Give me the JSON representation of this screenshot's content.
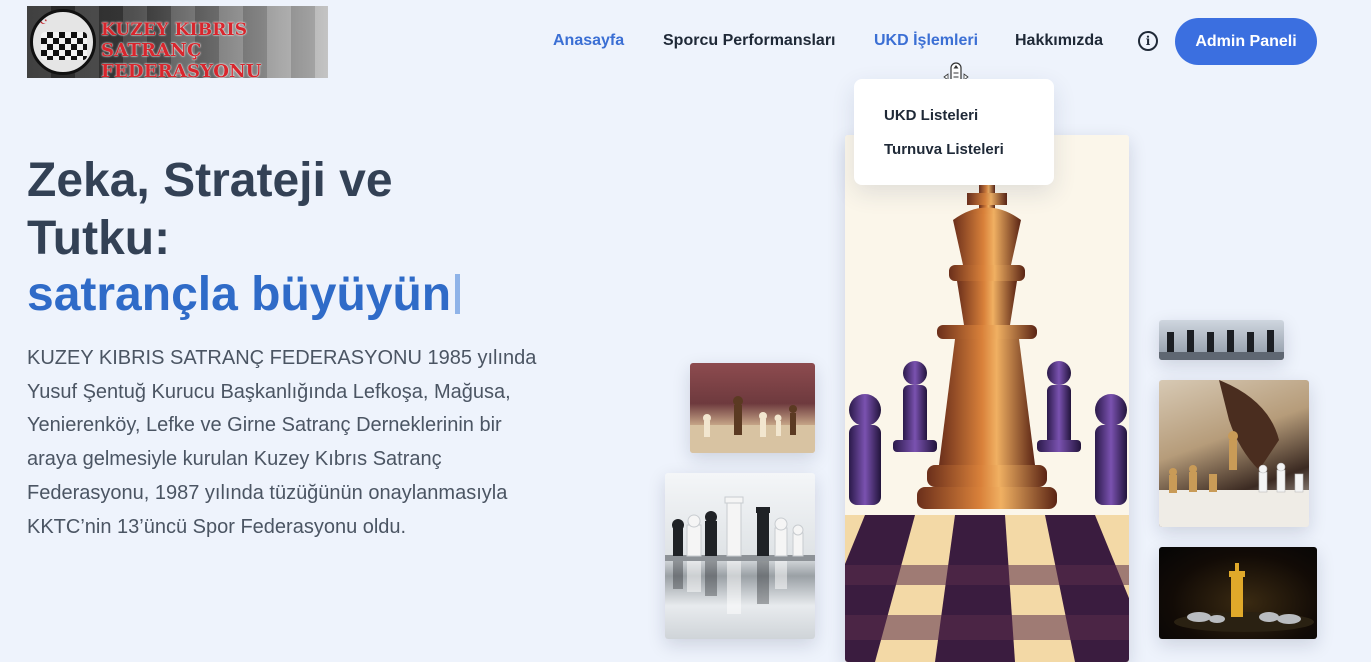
{
  "logo": {
    "line1": "KUZEY KIBRIS",
    "line2": "SATRANÇ FEDERASYONU"
  },
  "nav": {
    "items": [
      {
        "label": "Anasayfa",
        "active": true
      },
      {
        "label": "Sporcu Performansları",
        "active": false
      },
      {
        "label": "UKD İşlemleri",
        "active": true
      },
      {
        "label": "Hakkımızda",
        "active": false
      }
    ],
    "info_icon": "info-circle-icon",
    "admin_label": "Admin Paneli"
  },
  "dropdown": {
    "items": [
      {
        "label": "UKD Listeleri"
      },
      {
        "label": "Turnuva Listeleri"
      }
    ]
  },
  "hero": {
    "title": "Zeka, Strateji ve Tutku:",
    "accent": "satrançla büyüyün",
    "description": "KUZEY KIBRIS SATRANÇ FEDERASYONU 1985 yılında Yusuf Şentuğ Kurucu Başkanlığında Lefkoşa, Mağusa, Yenierenköy, Lefke ve Girne Satranç Derneklerinin bir araya gelmesiyle kurulan Kuzey Kıbrıs Satranç Federasyonu, 1987 yılında tüzüğünün onaylanmasıyla KKTC’nin 13’üncü Spor Federasyonu oldu."
  },
  "colors": {
    "background": "#eef3fc",
    "accent": "#2f6bc8",
    "nav_active": "#3b6fd4",
    "button": "#3b6fe0",
    "logo_text": "#d8262d"
  }
}
